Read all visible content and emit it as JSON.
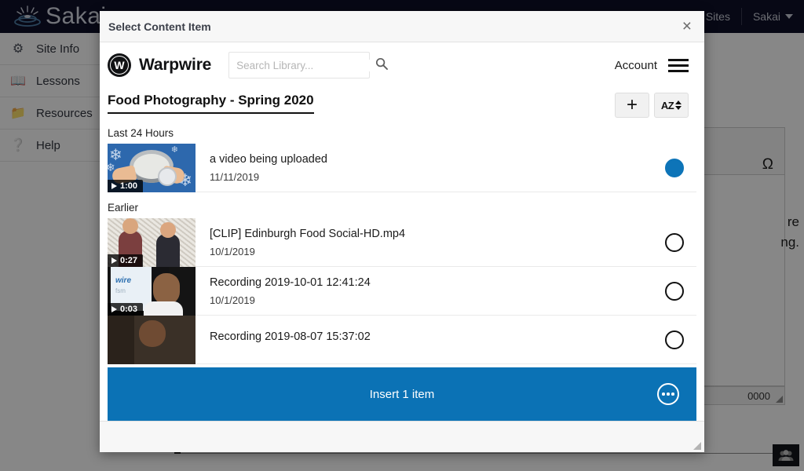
{
  "background": {
    "brand": "Sakai",
    "topbar": {
      "sites_label": "Sites",
      "user_label": "Sakai"
    },
    "sidebar": [
      {
        "label": "Site Info",
        "icon": "gear-icon"
      },
      {
        "label": "Lessons",
        "icon": "book-icon"
      },
      {
        "label": "Resources",
        "icon": "folder-icon"
      },
      {
        "label": "Help",
        "icon": "question-circle-icon"
      }
    ],
    "editor": {
      "special_char_glyph": "Ω",
      "body_text_line1": "re",
      "body_text_line2": "ng.",
      "footer_value": "0000"
    }
  },
  "modal": {
    "title": "Select Content Item",
    "close_label": "×"
  },
  "warpwire": {
    "brand_mark": "W",
    "brand_name": "Warpwire",
    "search": {
      "value": "",
      "placeholder": "Search Library..."
    },
    "account_label": "Account",
    "folder_title": "Food Photography - Spring 2020",
    "actions": {
      "add_label": "+",
      "sort_label": "AZ"
    },
    "accent_color": "#0b72b5",
    "sections": [
      {
        "label": "Last 24 Hours",
        "items": [
          {
            "title": "a video being uploaded",
            "date": "11/11/2019",
            "duration": "1:00",
            "selected": true,
            "thumb": "tb1"
          }
        ]
      },
      {
        "label": "Earlier",
        "items": [
          {
            "title": "[CLIP] Edinburgh Food Social-HD.mp4",
            "date": "10/1/2019",
            "duration": "0:27",
            "selected": false,
            "thumb": "tb2"
          },
          {
            "title": "Recording 2019-10-01 12:41:24",
            "date": "10/1/2019",
            "duration": "0:03",
            "selected": false,
            "thumb": "tb3"
          },
          {
            "title": "Recording 2019-08-07 15:37:02",
            "date": "",
            "duration": "",
            "selected": false,
            "thumb": "tb4"
          }
        ]
      }
    ],
    "insert_bar": {
      "label": "Insert 1 item",
      "more_label": "more-options"
    }
  }
}
